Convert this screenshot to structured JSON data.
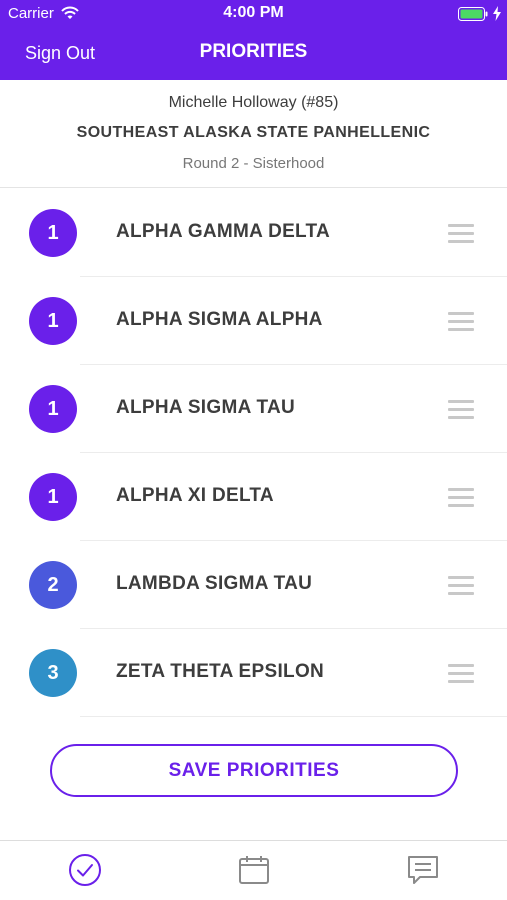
{
  "status_bar": {
    "carrier": "Carrier",
    "time": "4:00 PM",
    "icons": [
      "wifi-icon",
      "battery-icon",
      "charging-bolt-icon"
    ],
    "battery_color": "#4cd964"
  },
  "nav": {
    "left_button": "Sign Out",
    "title": "PRIORITIES",
    "background": "#6a20ea"
  },
  "header": {
    "name": "Michelle Holloway (#85)",
    "council": "SOUTHEAST ALASKA STATE PANHELLENIC",
    "round": "Round 2 - Sisterhood"
  },
  "priorities": [
    {
      "rank": "1",
      "name": "ALPHA GAMMA DELTA",
      "color": "#6a20ea"
    },
    {
      "rank": "1",
      "name": "ALPHA SIGMA ALPHA",
      "color": "#6a20ea"
    },
    {
      "rank": "1",
      "name": "ALPHA SIGMA TAU",
      "color": "#6a20ea"
    },
    {
      "rank": "1",
      "name": "ALPHA XI DELTA",
      "color": "#6a20ea"
    },
    {
      "rank": "2",
      "name": "LAMBDA SIGMA TAU",
      "color": "#4a59dc"
    },
    {
      "rank": "3",
      "name": "ZETA THETA EPSILON",
      "color": "#2f90c8"
    }
  ],
  "actions": {
    "save_label": "SAVE PRIORITIES"
  },
  "tab_bar": {
    "tabs": [
      {
        "icon": "checkmark-circle-icon",
        "active": true,
        "color": "#6a20ea"
      },
      {
        "icon": "calendar-icon",
        "active": false,
        "color": "#8a8a8a"
      },
      {
        "icon": "message-icon",
        "active": false,
        "color": "#8a8a8a"
      }
    ]
  }
}
